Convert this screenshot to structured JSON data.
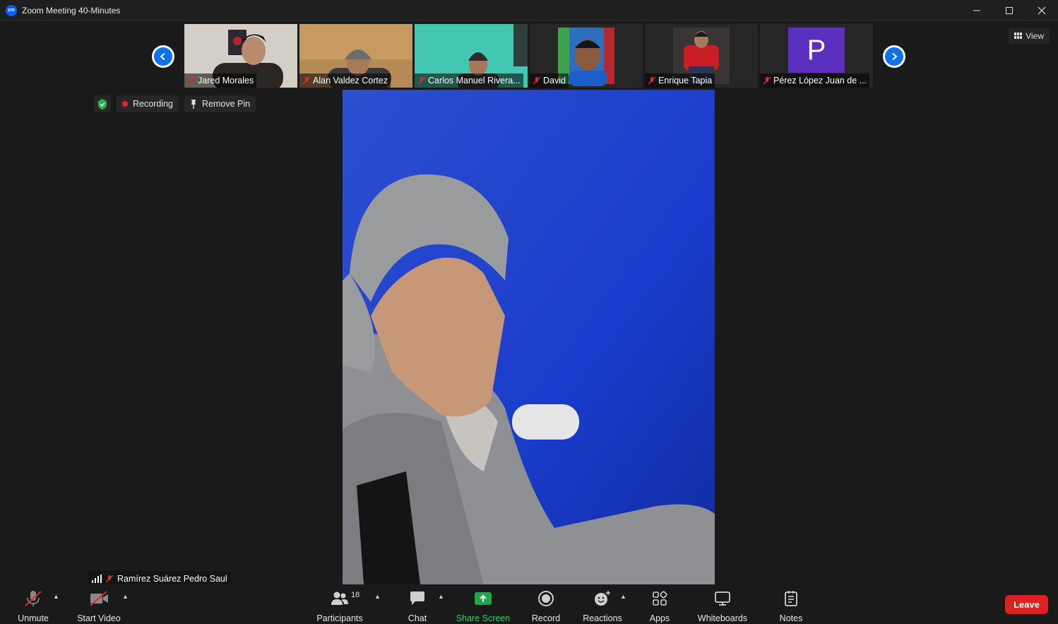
{
  "window": {
    "title": "Zoom Meeting 40-Minutes",
    "logo_text": "zm"
  },
  "participants_strip": [
    {
      "name": "Jared Morales",
      "type": "video"
    },
    {
      "name": "Alan Valdez Cortez",
      "type": "video"
    },
    {
      "name": "Carlos Manuel Rivera...",
      "type": "video"
    },
    {
      "name": "David",
      "type": "video"
    },
    {
      "name": "Enrique Tapia",
      "type": "video"
    },
    {
      "name": "Pérez López Juan de ...",
      "type": "avatar",
      "initial": "P"
    }
  ],
  "view_button": {
    "label": "View"
  },
  "status": {
    "recording_label": "Recording",
    "remove_pin_label": "Remove Pin"
  },
  "active_speaker": {
    "name": "Ramírez Suárez Pedro Saul"
  },
  "toolbar": {
    "unmute": "Unmute",
    "start_video": "Start Video",
    "participants": "Participants",
    "participants_count": "18",
    "chat": "Chat",
    "share_screen": "Share Screen",
    "record": "Record",
    "reactions": "Reactions",
    "apps": "Apps",
    "whiteboards": "Whiteboards",
    "notes": "Notes",
    "leave": "Leave"
  },
  "colors": {
    "accent_blue": "#0e72ed",
    "share_green": "#1ba94c",
    "leave_red": "#dc2121",
    "avatar_purple": "#5b2fbf",
    "recording_red": "#e02828"
  }
}
